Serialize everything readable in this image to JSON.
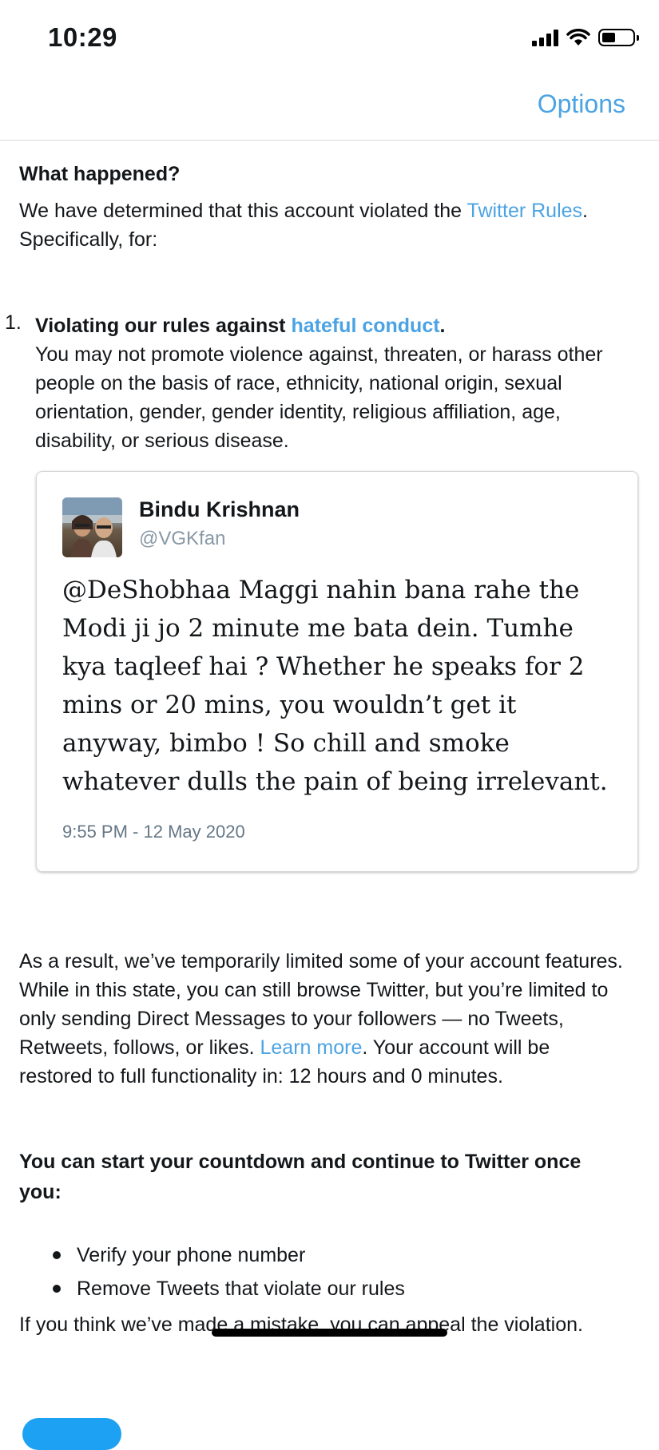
{
  "status_bar": {
    "time": "10:29",
    "battery_level": 0.45
  },
  "nav": {
    "options_label": "Options"
  },
  "what_happened": {
    "title": "What happened?",
    "body_before": "We have determined that this account violated the ",
    "rules_link": "Twitter Rules",
    "body_after": ". Specifically, for:"
  },
  "violation": {
    "number": "1.",
    "title_before": "Violating our rules against ",
    "title_link": "hateful conduct",
    "title_after": ".",
    "description": "You may not promote violence against, threaten, or harass other people on the basis of race, ethnicity, national origin, sexual orientation, gender, gender identity, religious affiliation, age, disability, or serious disease."
  },
  "tweet": {
    "author": "Bindu Krishnan",
    "handle": "@VGKfan",
    "text": "@DeShobhaa Maggi nahin bana rahe the Modi ji jo 2 minute me bata dein. Tumhe kya taqleef hai ? Whether he speaks for 2 mins or 20 mins, you wouldn’t get it anyway, bimbo ! So chill and smoke whatever dulls the pain of being irrelevant.",
    "timestamp": "9:55 PM - 12 May 2020"
  },
  "result": {
    "text_before": "As a result, we’ve temporarily limited some of your account features. While in this state, you can still browse Twitter, but you’re limited to only sending Direct Messages to your followers — no Tweets, Retweets, follows, or likes. ",
    "learn_more_link": "Learn more",
    "text_after": ". Your account will be restored to full functionality in: 12 hours and 0 minutes."
  },
  "countdown": {
    "title": "You can start your countdown and continue to Twitter once you:",
    "requirements": [
      "Verify your phone number",
      "Remove Tweets that violate our rules"
    ]
  },
  "appeal": {
    "text": "If you think we’ve made a mistake, you can appeal the violation."
  },
  "colors": {
    "link": "#4ba3e3",
    "button": "#1da1f2",
    "text": "#14171a",
    "secondary": "#657786"
  }
}
